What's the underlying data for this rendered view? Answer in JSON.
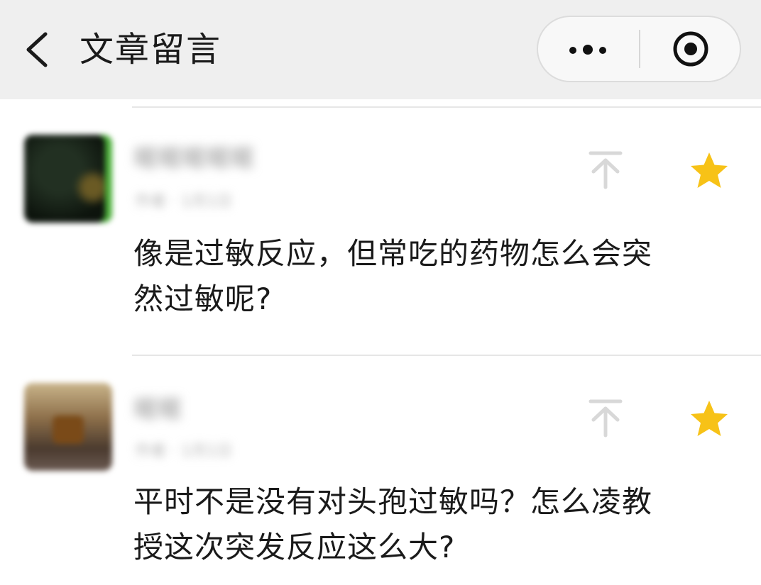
{
  "header": {
    "title": "文章留言",
    "back_icon": "chevron-left-icon",
    "more_icon": "more-dots-icon",
    "close_icon": "target-circle-icon"
  },
  "comments": [
    {
      "nickname": "暱暱暱暱暱",
      "meta": "作者 · 1月1日",
      "text": "像是过敏反应，但常吃的药物怎么会突\n然过敏呢?",
      "pin_icon": "pin-to-top-icon",
      "star_icon": "star-icon",
      "starred": true
    },
    {
      "nickname": "暱暱",
      "meta": "作者 · 1月1日",
      "text": "平时不是没有对头孢过敏吗？怎么凌教\n授这次突发反应这么大?",
      "pin_icon": "pin-to-top-icon",
      "star_icon": "star-icon",
      "starred": true
    }
  ],
  "colors": {
    "header_bg": "#efefef",
    "star": "#f7c217",
    "pin": "#d8d8d8",
    "divider": "#e6e6e6"
  }
}
